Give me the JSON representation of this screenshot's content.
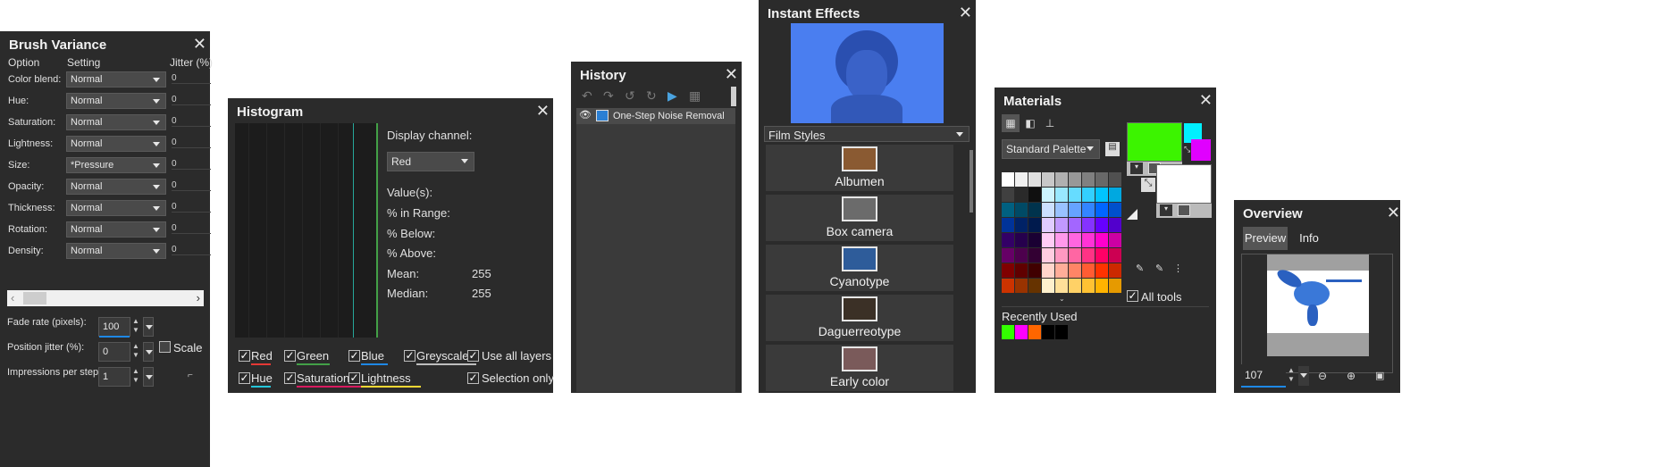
{
  "brush_variance": {
    "title": "Brush Variance",
    "col_option": "Option",
    "col_setting": "Setting",
    "col_jitter": "Jitter (%)",
    "rows": [
      {
        "option": "Color blend:",
        "setting": "Normal",
        "jitter": "0"
      },
      {
        "option": "Hue:",
        "setting": "Normal",
        "jitter": "0"
      },
      {
        "option": "Saturation:",
        "setting": "Normal",
        "jitter": "0"
      },
      {
        "option": "Lightness:",
        "setting": "Normal",
        "jitter": "0"
      },
      {
        "option": "Size:",
        "setting": "*Pressure",
        "jitter": "0"
      },
      {
        "option": "Opacity:",
        "setting": "Normal",
        "jitter": "0"
      },
      {
        "option": "Thickness:",
        "setting": "Normal",
        "jitter": "0"
      },
      {
        "option": "Rotation:",
        "setting": "Normal",
        "jitter": "0"
      },
      {
        "option": "Density:",
        "setting": "Normal",
        "jitter": "0"
      }
    ],
    "fade_rate_label": "Fade rate (pixels):",
    "fade_rate_value": "100",
    "position_jitter_label": "Position jitter (%):",
    "position_jitter_value": "0",
    "scale_label": "Scale",
    "impressions_label": "Impressions per step:",
    "impressions_value": "1"
  },
  "histogram": {
    "title": "Histogram",
    "display_channel_label": "Display channel:",
    "channel_value": "Red",
    "values_label": "Value(s):",
    "in_range_label": "% in Range:",
    "below_label": "% Below:",
    "above_label": "% Above:",
    "mean_label": "Mean:",
    "mean_value": "255",
    "median_label": "Median:",
    "median_value": "255",
    "checks": [
      {
        "label": "Red",
        "color": "#e53935"
      },
      {
        "label": "Green",
        "color": "#43a047"
      },
      {
        "label": "Blue",
        "color": "#1e88e5"
      },
      {
        "label": "Greyscale",
        "color": "#bdbdbd"
      },
      {
        "label": "Hue",
        "color": "#26c6da"
      },
      {
        "label": "Saturation",
        "color": "#d81b60"
      },
      {
        "label": "Lightness",
        "color": "#fdd835"
      }
    ],
    "use_all_layers": "Use all layers",
    "selection_only": "Selection only"
  },
  "history": {
    "title": "History",
    "item": "One-Step Noise Removal"
  },
  "instant_effects": {
    "title": "Instant Effects",
    "category": "Film Styles",
    "effects": [
      {
        "name": "Albumen",
        "color": "#8a5a32"
      },
      {
        "name": "Box camera",
        "color": "#6b6b6b"
      },
      {
        "name": "Cyanotype",
        "color": "#2e5c9a"
      },
      {
        "name": "Daguerreotype",
        "color": "#3b3026"
      },
      {
        "name": "Early color",
        "color": "#7a5a5a"
      }
    ]
  },
  "materials": {
    "title": "Materials",
    "palette": "Standard Palette",
    "recently_used_label": "Recently Used",
    "all_tools_label": "All tools",
    "foreground_color": "#3cf400",
    "background_color": "#ffffff",
    "fg_small": "#00f0ff",
    "bg_small": "#e000ff",
    "recent_colors": [
      "#33ff00",
      "#ff00ff",
      "#ff6600",
      "#000000",
      "#000000"
    ]
  },
  "overview": {
    "title": "Overview",
    "tab_preview": "Preview",
    "tab_info": "Info",
    "zoom_value": "107"
  }
}
